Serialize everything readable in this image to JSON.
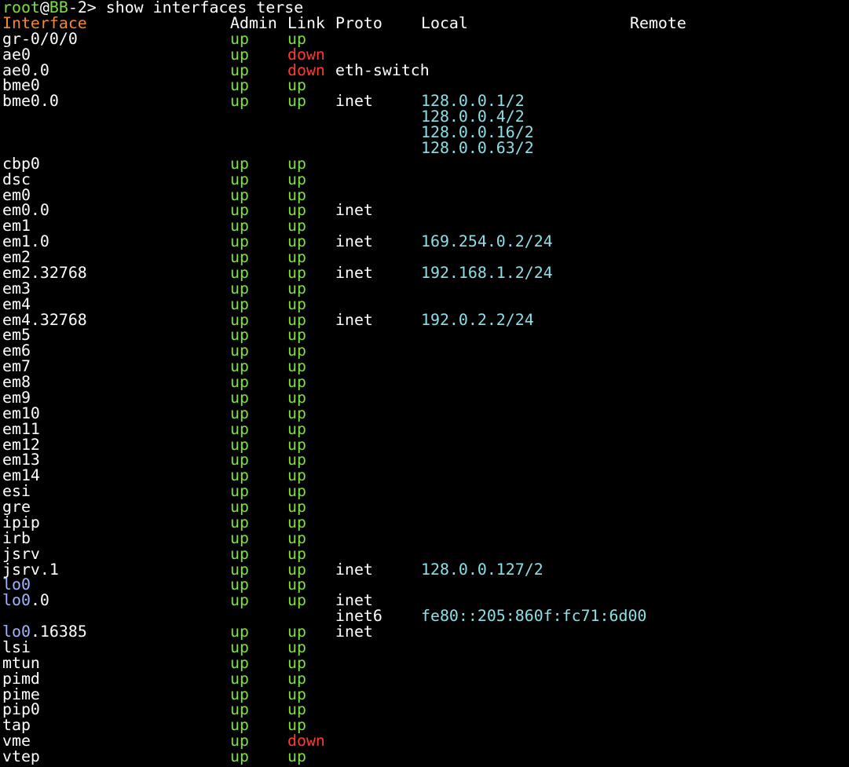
{
  "prompt": {
    "user": "root",
    "at": "@",
    "host": "BB",
    "suffix": "-2> ",
    "command": "show interfaces terse"
  },
  "header": {
    "interface": "Interface",
    "admin": "Admin",
    "link": "Link",
    "proto": "Proto",
    "local": "Local",
    "remote": "Remote"
  },
  "colors": {
    "background": "#000000",
    "up": "#7ee03a",
    "down": "#ff3b30",
    "address": "#8be0e8",
    "header_interface": "#f28a2e",
    "loopback": "#9fb6ff"
  },
  "rows": [
    {
      "iface": "gr-0/0/0",
      "admin": "up",
      "link": "up",
      "proto": "",
      "local": ""
    },
    {
      "iface": "ae0",
      "admin": "up",
      "link": "down",
      "proto": "",
      "local": ""
    },
    {
      "iface": "ae0.0",
      "admin": "up",
      "link": "down",
      "proto": "eth-switch",
      "local": ""
    },
    {
      "iface": "bme0",
      "admin": "up",
      "link": "up",
      "proto": "",
      "local": ""
    },
    {
      "iface": "bme0.0",
      "admin": "up",
      "link": "up",
      "proto": "inet",
      "local": "128.0.0.1/2"
    },
    {
      "iface": "",
      "admin": "",
      "link": "",
      "proto": "",
      "local": "128.0.0.4/2"
    },
    {
      "iface": "",
      "admin": "",
      "link": "",
      "proto": "",
      "local": "128.0.0.16/2"
    },
    {
      "iface": "",
      "admin": "",
      "link": "",
      "proto": "",
      "local": "128.0.0.63/2"
    },
    {
      "iface": "cbp0",
      "admin": "up",
      "link": "up",
      "proto": "",
      "local": ""
    },
    {
      "iface": "dsc",
      "admin": "up",
      "link": "up",
      "proto": "",
      "local": ""
    },
    {
      "iface": "em0",
      "admin": "up",
      "link": "up",
      "proto": "",
      "local": ""
    },
    {
      "iface": "em0.0",
      "admin": "up",
      "link": "up",
      "proto": "inet",
      "local": ""
    },
    {
      "iface": "em1",
      "admin": "up",
      "link": "up",
      "proto": "",
      "local": ""
    },
    {
      "iface": "em1.0",
      "admin": "up",
      "link": "up",
      "proto": "inet",
      "local": "169.254.0.2/24"
    },
    {
      "iface": "em2",
      "admin": "up",
      "link": "up",
      "proto": "",
      "local": ""
    },
    {
      "iface": "em2.32768",
      "admin": "up",
      "link": "up",
      "proto": "inet",
      "local": "192.168.1.2/24"
    },
    {
      "iface": "em3",
      "admin": "up",
      "link": "up",
      "proto": "",
      "local": ""
    },
    {
      "iface": "em4",
      "admin": "up",
      "link": "up",
      "proto": "",
      "local": ""
    },
    {
      "iface": "em4.32768",
      "admin": "up",
      "link": "up",
      "proto": "inet",
      "local": "192.0.2.2/24"
    },
    {
      "iface": "em5",
      "admin": "up",
      "link": "up",
      "proto": "",
      "local": ""
    },
    {
      "iface": "em6",
      "admin": "up",
      "link": "up",
      "proto": "",
      "local": ""
    },
    {
      "iface": "em7",
      "admin": "up",
      "link": "up",
      "proto": "",
      "local": ""
    },
    {
      "iface": "em8",
      "admin": "up",
      "link": "up",
      "proto": "",
      "local": ""
    },
    {
      "iface": "em9",
      "admin": "up",
      "link": "up",
      "proto": "",
      "local": ""
    },
    {
      "iface": "em10",
      "admin": "up",
      "link": "up",
      "proto": "",
      "local": ""
    },
    {
      "iface": "em11",
      "admin": "up",
      "link": "up",
      "proto": "",
      "local": ""
    },
    {
      "iface": "em12",
      "admin": "up",
      "link": "up",
      "proto": "",
      "local": ""
    },
    {
      "iface": "em13",
      "admin": "up",
      "link": "up",
      "proto": "",
      "local": ""
    },
    {
      "iface": "em14",
      "admin": "up",
      "link": "up",
      "proto": "",
      "local": ""
    },
    {
      "iface": "esi",
      "admin": "up",
      "link": "up",
      "proto": "",
      "local": ""
    },
    {
      "iface": "gre",
      "admin": "up",
      "link": "up",
      "proto": "",
      "local": ""
    },
    {
      "iface": "ipip",
      "admin": "up",
      "link": "up",
      "proto": "",
      "local": ""
    },
    {
      "iface": "irb",
      "admin": "up",
      "link": "up",
      "proto": "",
      "local": ""
    },
    {
      "iface": "jsrv",
      "admin": "up",
      "link": "up",
      "proto": "",
      "local": ""
    },
    {
      "iface": "jsrv.1",
      "admin": "up",
      "link": "up",
      "proto": "inet",
      "local": "128.0.0.127/2"
    },
    {
      "iface": "lo0",
      "admin": "up",
      "link": "up",
      "proto": "",
      "local": ""
    },
    {
      "iface": "lo0.0",
      "admin": "up",
      "link": "up",
      "proto": "inet",
      "local": ""
    },
    {
      "iface": "",
      "admin": "",
      "link": "",
      "proto": "inet6",
      "local": "fe80::205:860f:fc71:6d00"
    },
    {
      "iface": "lo0.16385",
      "admin": "up",
      "link": "up",
      "proto": "inet",
      "local": ""
    },
    {
      "iface": "lsi",
      "admin": "up",
      "link": "up",
      "proto": "",
      "local": ""
    },
    {
      "iface": "mtun",
      "admin": "up",
      "link": "up",
      "proto": "",
      "local": ""
    },
    {
      "iface": "pimd",
      "admin": "up",
      "link": "up",
      "proto": "",
      "local": ""
    },
    {
      "iface": "pime",
      "admin": "up",
      "link": "up",
      "proto": "",
      "local": ""
    },
    {
      "iface": "pip0",
      "admin": "up",
      "link": "up",
      "proto": "",
      "local": ""
    },
    {
      "iface": "tap",
      "admin": "up",
      "link": "up",
      "proto": "",
      "local": ""
    },
    {
      "iface": "vme",
      "admin": "up",
      "link": "down",
      "proto": "",
      "local": ""
    },
    {
      "iface": "vtep",
      "admin": "up",
      "link": "up",
      "proto": "",
      "local": ""
    }
  ]
}
